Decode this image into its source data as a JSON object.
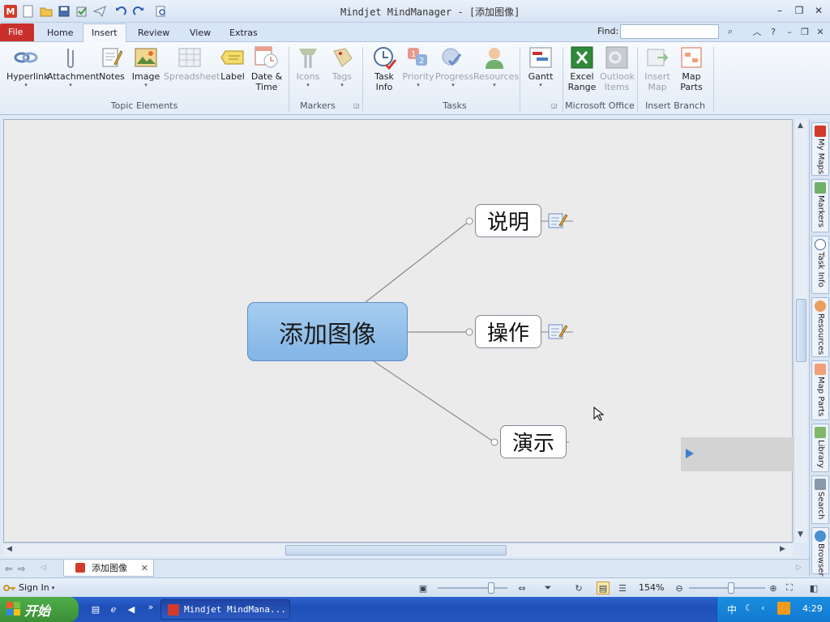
{
  "window": {
    "title": "Mindjet MindManager - [添加图像]",
    "app_badge": "M"
  },
  "tabs": {
    "file": "File",
    "home": "Home",
    "insert": "Insert",
    "review": "Review",
    "view": "View",
    "extras": "Extras"
  },
  "find": {
    "label": "Find:",
    "value": ""
  },
  "ribbon": {
    "groups": {
      "topic_elements": "Topic Elements",
      "markers": "Markers",
      "tasks": "Tasks",
      "microsoft_office": "Microsoft Office",
      "insert_branch": "Insert Branch"
    },
    "buttons": {
      "hyperlink": "Hyperlink",
      "attachment": "Attachment",
      "notes": "Notes",
      "image": "Image",
      "spreadsheet": "Spreadsheet",
      "label": "Label",
      "date_time_1": "Date &",
      "date_time_2": "Time",
      "icons": "Icons",
      "tags": "Tags",
      "task_info_1": "Task",
      "task_info_2": "Info",
      "priority": "Priority",
      "progress": "Progress",
      "resources": "Resources",
      "gantt": "Gantt",
      "excel_1": "Excel",
      "excel_2": "Range",
      "outlook_1": "Outlook",
      "outlook_2": "Items",
      "insert_map_1": "Insert",
      "insert_map_2": "Map",
      "map_parts_1": "Map",
      "map_parts_2": "Parts"
    }
  },
  "mindmap": {
    "central": "添加图像",
    "topics": [
      {
        "label": "说明",
        "has_note": true
      },
      {
        "label": "操作",
        "has_note": true
      },
      {
        "label": "演示",
        "has_note": false
      }
    ]
  },
  "side_tabs": [
    "My Maps",
    "Markers",
    "Task Info",
    "Resources",
    "Map Parts",
    "Library",
    "Search",
    "Browser"
  ],
  "doc_tab": {
    "label": "添加图像"
  },
  "status": {
    "sign_in": "Sign In",
    "zoom": "154%"
  },
  "taskbar": {
    "start": "开始",
    "task_item": "Mindjet MindMana...",
    "ime": "中",
    "clock": "4:29"
  },
  "colors": {
    "central_fill": "#8fbfea",
    "file_tab": "#c9302c",
    "taskbar": "#2457c2",
    "start": "#3f9a3a"
  }
}
